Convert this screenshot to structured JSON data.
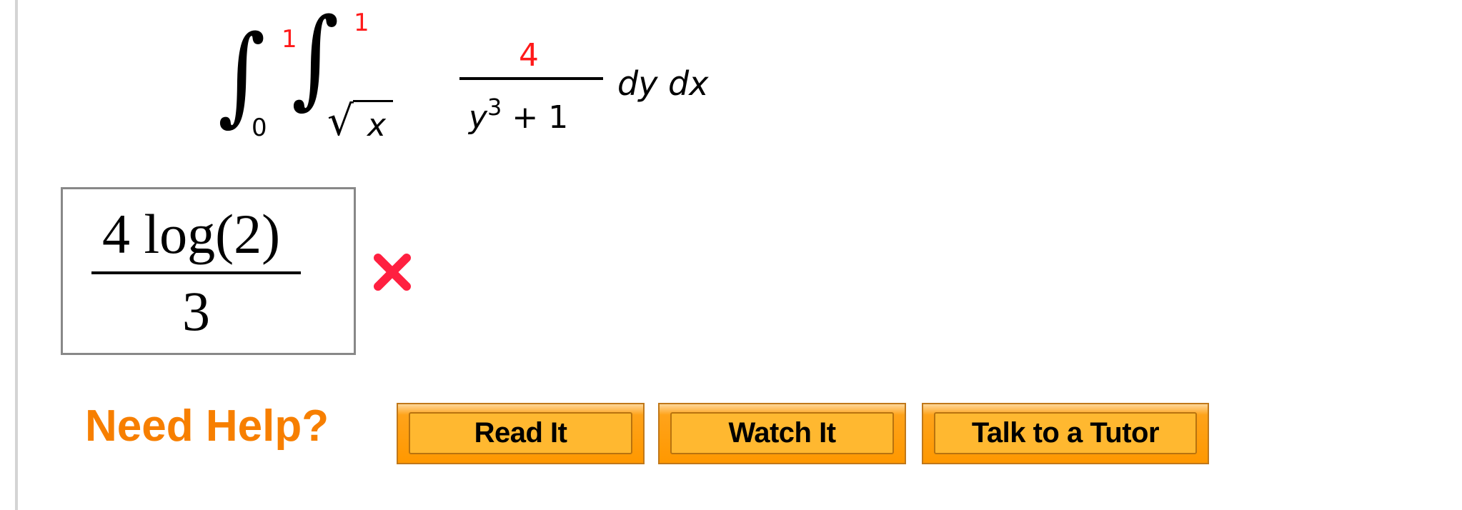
{
  "problem": {
    "outer_integral": {
      "lower": "0",
      "upper": "1"
    },
    "inner_integral": {
      "lower_radicand": "x",
      "upper": "1"
    },
    "integrand": {
      "numerator": "4",
      "denominator_base": "y",
      "denominator_exponent": "3",
      "denominator_rest": " + 1"
    },
    "differentials": "dy dx",
    "highlight_color": "#ff1a1a"
  },
  "answer": {
    "numerator": "4 log(2)",
    "denominator": "3",
    "status": "incorrect",
    "status_icon": "red-x-icon",
    "status_color": "#ff2040"
  },
  "help": {
    "label": "Need Help?",
    "label_color": "#f77f00",
    "buttons": [
      {
        "label": "Read It"
      },
      {
        "label": "Watch It"
      },
      {
        "label": "Talk to a Tutor"
      }
    ],
    "button_color": "#ffa31a"
  }
}
